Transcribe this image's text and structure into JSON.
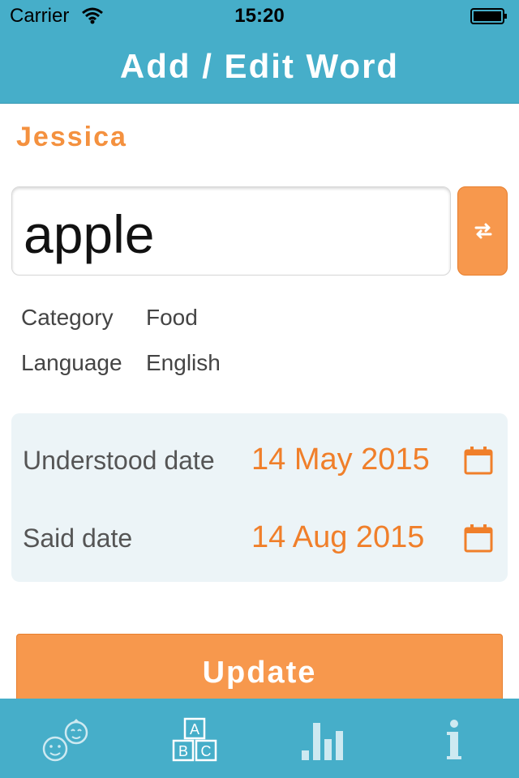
{
  "status_bar": {
    "carrier": "Carrier",
    "time": "15:20"
  },
  "nav": {
    "title": "Add / Edit Word"
  },
  "child_name": "Jessica",
  "word": {
    "value": "apple"
  },
  "meta": {
    "category_label": "Category",
    "category_value": "Food",
    "language_label": "Language",
    "language_value": "English"
  },
  "dates": {
    "understood_label": "Understood date",
    "understood_value": "14 May 2015",
    "said_label": "Said date",
    "said_value": "14 Aug 2015"
  },
  "update_button": "Update",
  "tabbar": {
    "items": [
      {
        "icon": "children-icon"
      },
      {
        "icon": "abc-blocks-icon"
      },
      {
        "icon": "bar-chart-icon"
      },
      {
        "icon": "info-icon"
      }
    ]
  },
  "colors": {
    "header": "#46aec9",
    "accent": "#f7984d",
    "date_text": "#f07f2a",
    "dates_panel": "#ecf4f7"
  }
}
